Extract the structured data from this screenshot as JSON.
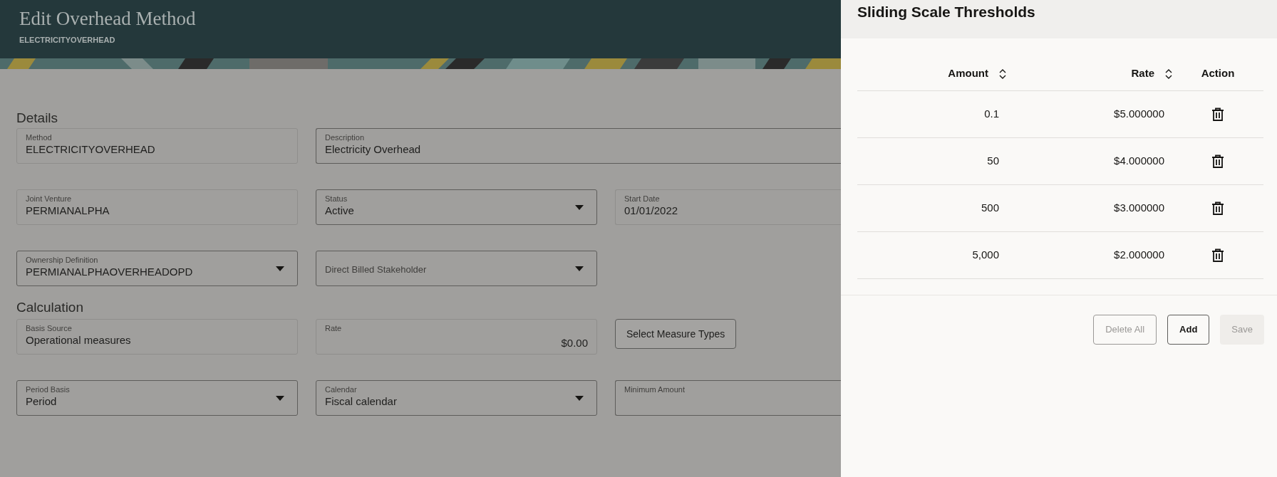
{
  "header": {
    "title": "Edit Overhead Method",
    "subtitle": "ELECTRICITYOVERHEAD"
  },
  "sections": [
    {
      "title": "Details",
      "rows": [
        [
          {
            "kind": "text",
            "label": "Method",
            "value": "ELECTRICITYOVERHEAD",
            "readonly": true
          },
          {
            "kind": "text",
            "label": "Description",
            "value": "Electricity Overhead",
            "readonly": false
          }
        ],
        [
          {
            "kind": "text",
            "label": "Joint Venture",
            "value": "PERMIANALPHA",
            "readonly": true
          },
          {
            "kind": "select",
            "label": "Status",
            "value": "Active",
            "readonly": false
          },
          {
            "kind": "text",
            "label": "Start Date",
            "value": "01/01/2022",
            "readonly": true
          }
        ],
        [
          {
            "kind": "select",
            "label": "Ownership Definition",
            "value": "PERMIANALPHAOVERHEADOPD",
            "readonly": false
          },
          {
            "kind": "select",
            "placeholder": "Direct Billed Stakeholder",
            "readonly": false
          }
        ]
      ]
    },
    {
      "title": "Calculation",
      "rows": [
        [
          {
            "kind": "text",
            "label": "Basis Source",
            "value": "Operational measures",
            "readonly": true
          },
          {
            "kind": "number",
            "label": "Rate",
            "value": "$0.00",
            "readonly": true
          },
          {
            "kind": "button",
            "label": "Select Measure Types"
          }
        ],
        [
          {
            "kind": "select",
            "label": "Period Basis",
            "value": "Period",
            "readonly": false
          },
          {
            "kind": "select",
            "label": "Calendar",
            "value": "Fiscal calendar",
            "readonly": false
          },
          {
            "kind": "text",
            "label": "Minimum Amount",
            "readonly": false
          }
        ]
      ]
    }
  ],
  "panel": {
    "title": "Sliding Scale Thresholds",
    "table": {
      "columns": [
        {
          "label": "Amount",
          "sortable": true
        },
        {
          "label": "Rate",
          "sortable": true
        },
        {
          "label": "Action",
          "sortable": false
        }
      ],
      "rows": [
        {
          "amount": "0.1",
          "rate": "$5.000000"
        },
        {
          "amount": "50",
          "rate": "$4.000000"
        },
        {
          "amount": "500",
          "rate": "$3.000000"
        },
        {
          "amount": "5,000",
          "rate": "$2.000000"
        }
      ]
    },
    "buttons": [
      {
        "label": "Delete All",
        "kind": "outline",
        "disabled": true
      },
      {
        "label": "Add",
        "kind": "outline",
        "disabled": false
      },
      {
        "label": "Save",
        "kind": "solid",
        "disabled": true
      }
    ]
  }
}
